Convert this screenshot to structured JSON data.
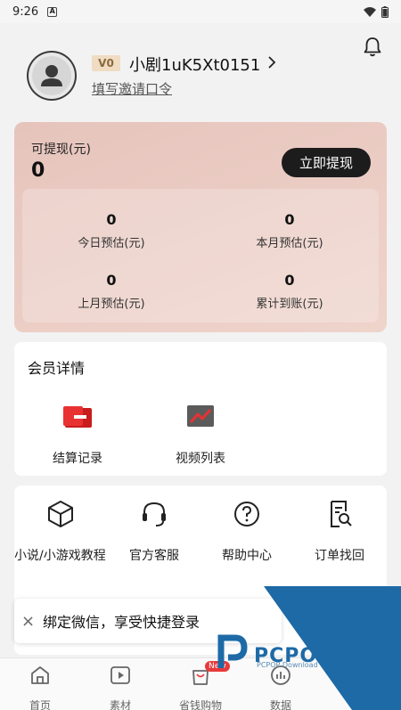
{
  "status_bar": {
    "time": "9:26",
    "notice_glyph": "A"
  },
  "profile": {
    "level": "V0",
    "username": "小剧1uK5Xt0151",
    "invite_link": "填写邀请口令"
  },
  "earnings": {
    "withdrawable_label": "可提现(元)",
    "withdrawable_value": "0",
    "withdraw_button": "立即提现",
    "stats": [
      {
        "value": "0",
        "label": "今日预估(元)"
      },
      {
        "value": "0",
        "label": "本月预估(元)"
      },
      {
        "value": "0",
        "label": "上月预估(元)"
      },
      {
        "value": "0",
        "label": "累计到账(元)"
      }
    ]
  },
  "member": {
    "title": "会员详情",
    "items": [
      {
        "label": "结算记录",
        "icon": "settlement-record-icon"
      },
      {
        "label": "视频列表",
        "icon": "video-list-icon"
      }
    ]
  },
  "tools": [
    {
      "label": "小说/小游戏教程",
      "icon": "cube-icon"
    },
    {
      "label": "官方客服",
      "icon": "headset-icon"
    },
    {
      "label": "帮助中心",
      "icon": "question-icon"
    },
    {
      "label": "订单找回",
      "icon": "order-search-icon"
    }
  ],
  "toast": {
    "text": "绑定微信，享受快捷登录"
  },
  "tabbar": {
    "tabs": [
      {
        "label": "首页",
        "icon": "home-icon"
      },
      {
        "label": "素材",
        "icon": "play-icon"
      },
      {
        "label": "省钱购物",
        "icon": "shopping-bag-icon",
        "badge": "New"
      },
      {
        "label": "数据",
        "icon": "bar-chart-icon"
      }
    ]
  },
  "watermark": {
    "brand": "PCPOP下载",
    "sub": "PCPOP Download"
  },
  "colors": {
    "card_gradient_start": "#e6c4bc",
    "card_gradient_end": "#efd4cb",
    "button_dark": "#1c1c1c",
    "badge_red": "#e83a3a",
    "watermark_blue": "#1d6aa6"
  }
}
